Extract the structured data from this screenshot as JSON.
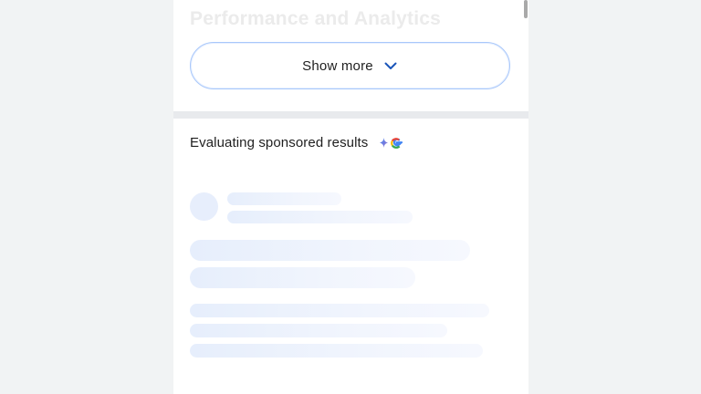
{
  "previous_section": {
    "heading": "Performance and Analytics"
  },
  "show_more": {
    "label": "Show more",
    "icon": "chevron-down-icon"
  },
  "sponsored_section": {
    "title": "Evaluating sponsored results",
    "badge_icon": "ai-sparkle-google-icon"
  },
  "colors": {
    "page_background": "#f1f3f4",
    "panel_background": "#ffffff",
    "button_border": "#a8c7fa",
    "chevron": "#1a55b9",
    "skeleton": "#e6eefc",
    "divider": "#e8eaed"
  },
  "loading_state": {
    "status": "loading"
  }
}
